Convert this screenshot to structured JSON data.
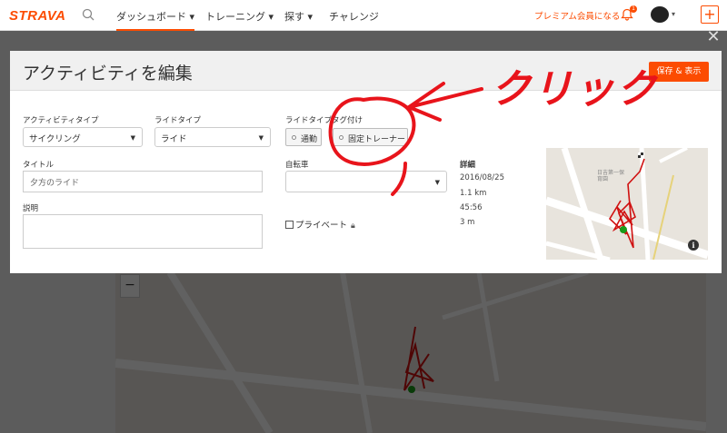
{
  "nav": {
    "logo": "STRAVA",
    "items": [
      {
        "label": "ダッシュボード ▾"
      },
      {
        "label": "トレーニング ▾"
      },
      {
        "label": "探す ▾"
      },
      {
        "label": "チャレンジ"
      }
    ],
    "premium": "プレミアム会員になる",
    "badge_count": "1"
  },
  "modal": {
    "title": "アクティビティを編集",
    "save_label": "保存 & 表示",
    "activity_type": {
      "label": "アクティビティタイプ",
      "value": "サイクリング"
    },
    "ride_type": {
      "label": "ライドタイプ",
      "value": "ライド"
    },
    "ride_tags": {
      "label": "ライドタイプタグ付け",
      "tags": [
        "通勤",
        "固定トレーナー"
      ]
    },
    "title_field": {
      "label": "タイトル",
      "value": "夕方のライド"
    },
    "bike": {
      "label": "自転車",
      "value": ""
    },
    "description": {
      "label": "説明",
      "value": ""
    },
    "privacy_label": "プライベート",
    "details": {
      "label": "詳細",
      "date": "2016/08/25",
      "distance": "1.1 km",
      "time": "45:56",
      "elevation": "3 m"
    },
    "map_place_label": "日吉第一保育園"
  },
  "annotation": {
    "text": "クリック",
    "color": "#e8141b"
  },
  "colors": {
    "accent": "#fc4c02"
  }
}
